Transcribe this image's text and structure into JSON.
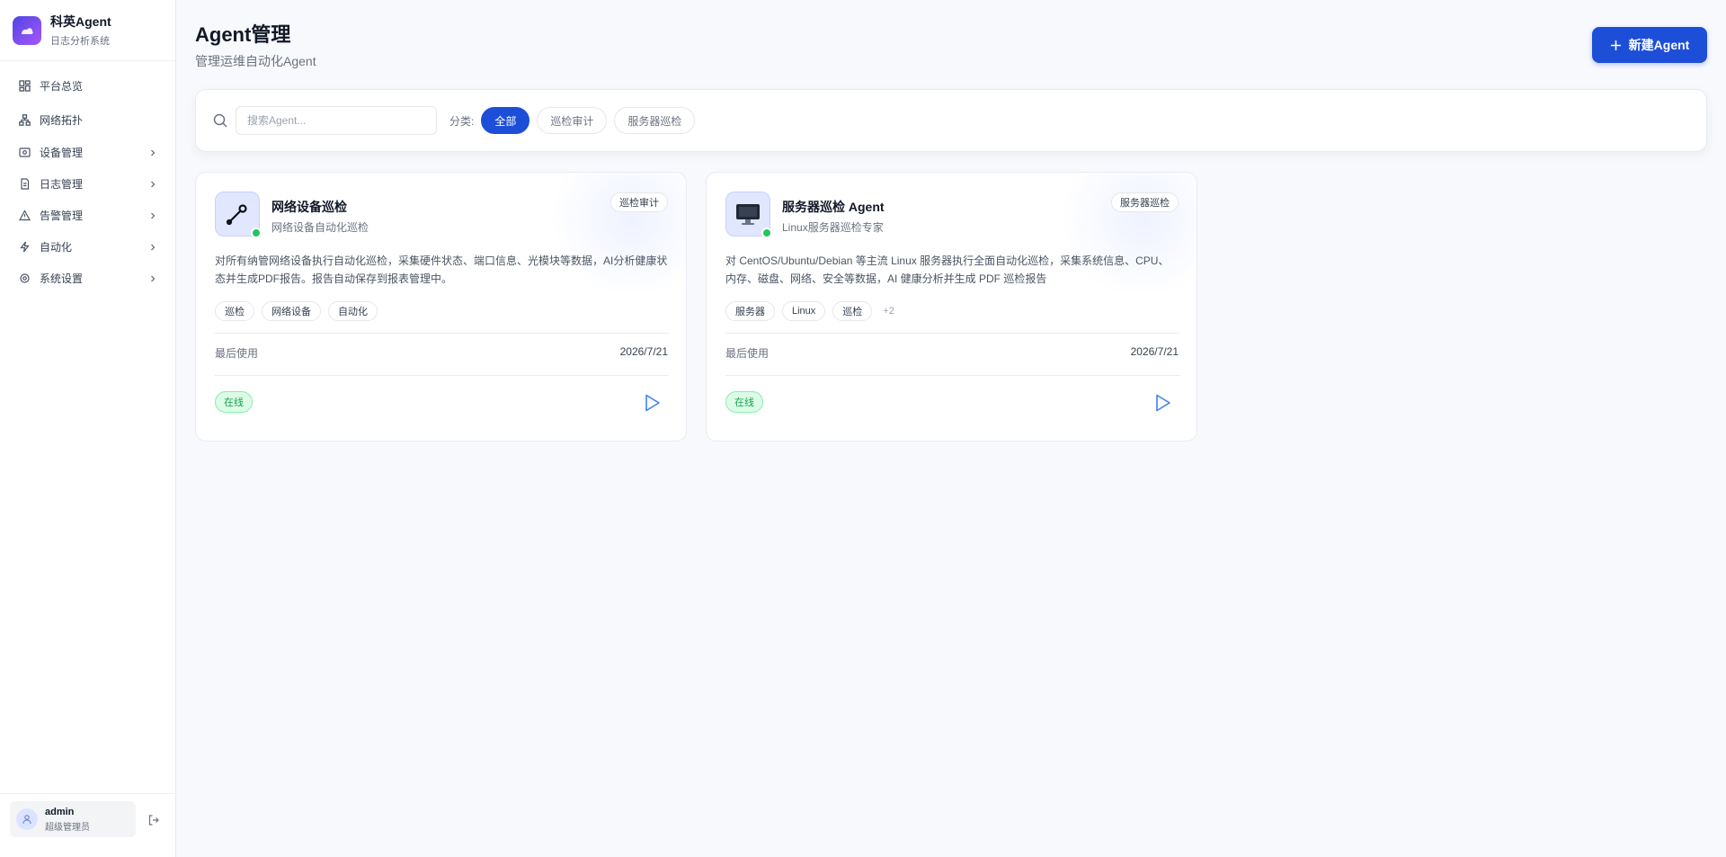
{
  "brand": {
    "title": "科英Agent",
    "subtitle": "日志分析系统"
  },
  "nav": {
    "items": [
      {
        "label": "平台总览",
        "icon": "dashboard-icon"
      },
      {
        "label": "网络拓扑",
        "icon": "topology-icon"
      },
      {
        "label": "设备管理",
        "icon": "device-icon"
      },
      {
        "label": "日志管理",
        "icon": "document-icon"
      },
      {
        "label": "告警管理",
        "icon": "warning-icon"
      },
      {
        "label": "自动化",
        "icon": "bolt-icon"
      },
      {
        "label": "系统设置",
        "icon": "gear-icon"
      }
    ]
  },
  "user": {
    "name": "admin",
    "role": "超级管理员"
  },
  "header": {
    "title": "Agent管理",
    "subtitle": "管理运维自动化Agent",
    "new_button": "新建Agent"
  },
  "filter": {
    "search_placeholder": "搜索Agent...",
    "category_label": "分类:",
    "categories": [
      "全部",
      "巡检审计",
      "服务器巡检"
    ],
    "active_category": "全部"
  },
  "cards": [
    {
      "title": "网络设备巡检",
      "subtitle": "网络设备自动化巡检",
      "badge": "巡检审计",
      "description": "对所有纳管网络设备执行自动化巡检，采集硬件状态、端口信息、光模块等数据，AI分析健康状态并生成PDF报告。报告自动保存到报表管理中。",
      "tags": [
        "巡检",
        "网络设备",
        "自动化"
      ],
      "more_tags": "",
      "last_used_label": "最后使用",
      "last_used": "2026/7/21",
      "status": "在线",
      "icon": "wrench-icon"
    },
    {
      "title": "服务器巡检 Agent",
      "subtitle": "Linux服务器巡检专家",
      "badge": "服务器巡检",
      "description": "对 CentOS/Ubuntu/Debian 等主流 Linux 服务器执行全面自动化巡检，采集系统信息、CPU、内存、磁盘、网络、安全等数据，AI 健康分析并生成 PDF 巡检报告",
      "tags": [
        "服务器",
        "Linux",
        "巡检"
      ],
      "more_tags": "+2",
      "last_used_label": "最后使用",
      "last_used": "2026/7/21",
      "status": "在线",
      "icon": "monitor-icon"
    }
  ],
  "colors": {
    "primary": "#1d4ed8",
    "online": "#22c55e",
    "background": "#f8f9fc"
  }
}
